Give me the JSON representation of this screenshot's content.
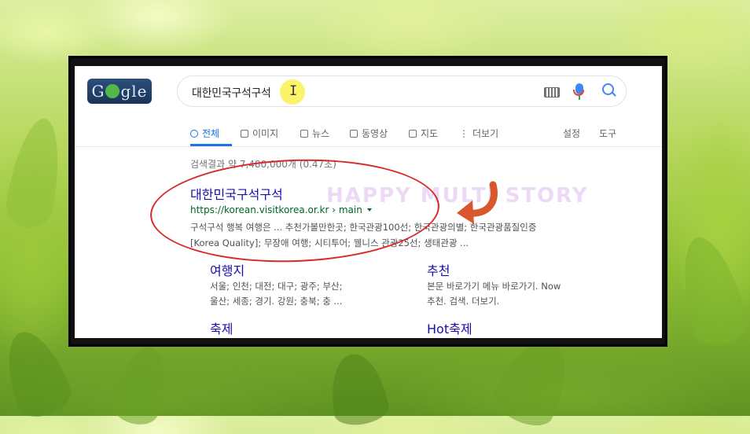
{
  "search": {
    "query": "대한민국구석구석"
  },
  "logo": {
    "left": "G",
    "right": "gle"
  },
  "tabs": [
    {
      "label": "전체",
      "icon": "search-icon",
      "active": true
    },
    {
      "label": "이미지",
      "icon": "image-icon",
      "active": false
    },
    {
      "label": "뉴스",
      "icon": "news-icon",
      "active": false
    },
    {
      "label": "동영상",
      "icon": "video-icon",
      "active": false
    },
    {
      "label": "지도",
      "icon": "map-icon",
      "active": false
    },
    {
      "label": "더보기",
      "icon": "more-icon",
      "active": false
    }
  ],
  "tools": {
    "settings": "설정",
    "tools": "도구"
  },
  "stats": "검색결과 약 7,480,000개 (0.47초)",
  "result": {
    "title": "대한민국구석구석",
    "url": "https://korean.visitkorea.or.kr › main",
    "snippet_line1": "구석구석 행복 여행은 ... 추천가볼만한곳; 한국관광100선; 한국관광의별; 한국관광품질인증",
    "snippet_line2": "[Korea Quality]; 무장애 여행; 시티투어; 웰니스 관광25선; 생태관광 ..."
  },
  "sitelinks": [
    {
      "title": "여행지",
      "line1": "서울; 인천; 대전; 대구; 광주; 부산;",
      "line2": "울산; 세종; 경기. 강원; 충북; 충 ..."
    },
    {
      "title": "추천",
      "line1": "본문 바로가기 메뉴 바로가기. Now",
      "line2": "추천. 검색. 더보기."
    },
    {
      "title": "축제",
      "line1": "",
      "line2": ""
    },
    {
      "title": "Hot축제",
      "line1": "",
      "line2": ""
    }
  ],
  "watermark": "HAPPY MULTI STORY",
  "colors": {
    "link": "#1a0dab",
    "url": "#006621",
    "accent": "#1a73e8",
    "annotation": "#d8282c"
  }
}
